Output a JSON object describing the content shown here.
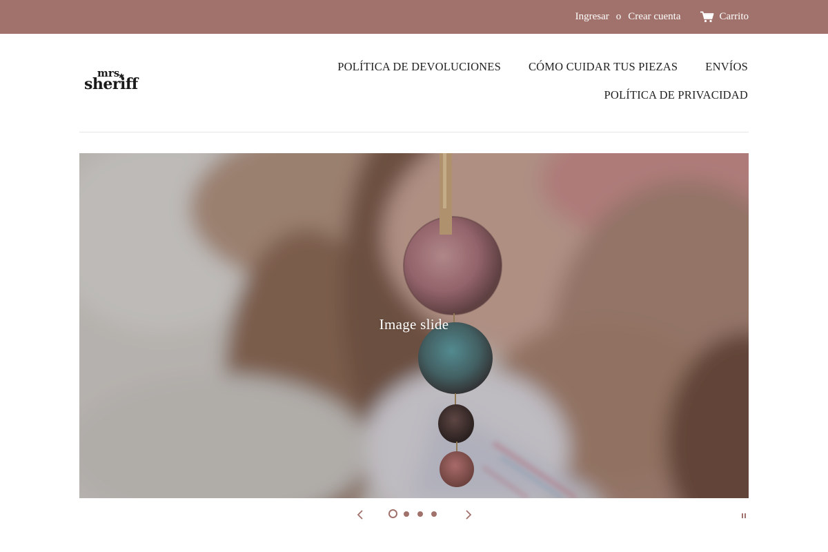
{
  "topbar": {
    "login_label": "Ingresar",
    "separator": "o",
    "create_account_label": "Crear cuenta",
    "cart_label": "Carrito",
    "background_color": "#a1726b",
    "cart_icon": "cart-icon"
  },
  "logo": {
    "line1": "mrs",
    "line2": "sheriff",
    "star": "✱"
  },
  "nav": {
    "row1": [
      "POLÍTICA DE DEVOLUCIONES",
      "CÓMO CUIDAR TUS PIEZAS",
      "ENVÍOS"
    ],
    "row2": [
      "POLÍTICA DE PRIVACIDAD"
    ]
  },
  "slideshow": {
    "caption": "Image slide",
    "total_slides": 4,
    "active_slide": 1,
    "accent_color": "#a1726b",
    "prev_icon": "chevron-left-icon",
    "next_icon": "chevron-right-icon",
    "pause_icon": "pause-icon"
  }
}
